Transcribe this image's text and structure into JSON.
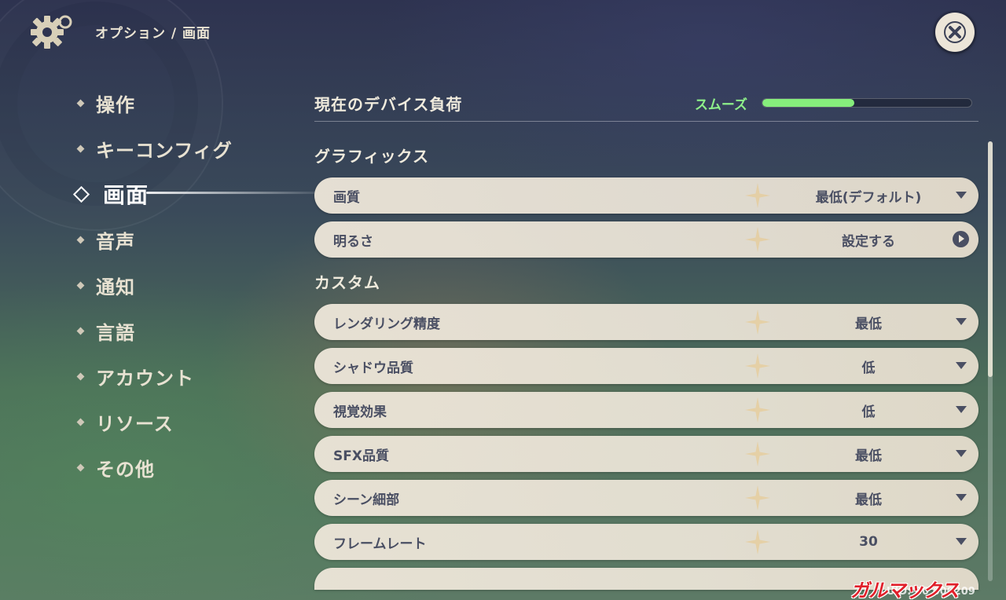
{
  "header": {
    "breadcrumb": "オプション / 画面"
  },
  "sidebar": {
    "items": [
      {
        "label": "操作"
      },
      {
        "label": "キーコンフィグ"
      },
      {
        "label": "画面"
      },
      {
        "label": "音声"
      },
      {
        "label": "通知"
      },
      {
        "label": "言語"
      },
      {
        "label": "アカウント"
      },
      {
        "label": "リソース"
      },
      {
        "label": "その他"
      }
    ],
    "active": "画面"
  },
  "device_load": {
    "title": "現在のデバイス負荷",
    "status": "スムーズ",
    "level": 0.44,
    "status_color": "#86ee7c"
  },
  "sections": {
    "graphics": "グラフィックス",
    "custom": "カスタム"
  },
  "graphics_options": [
    {
      "label": "画質",
      "value": "最低(デフォルト)",
      "control": "dropdown"
    },
    {
      "label": "明るさ",
      "value": "設定する",
      "control": "arrow"
    }
  ],
  "custom_options": [
    {
      "label": "レンダリング精度",
      "value": "最低",
      "control": "dropdown"
    },
    {
      "label": "シャドウ品質",
      "value": "低",
      "control": "dropdown"
    },
    {
      "label": "視覚効果",
      "value": "低",
      "control": "dropdown"
    },
    {
      "label": "SFX品質",
      "value": "最低",
      "control": "dropdown"
    },
    {
      "label": "シーン細部",
      "value": "最低",
      "control": "dropdown"
    },
    {
      "label": "フレームレート",
      "value": "30",
      "control": "dropdown"
    }
  ],
  "footer": {
    "uid": "UID: 80 600209",
    "watermark": "ガルマックス"
  },
  "icons": {
    "settings": "gear-icon",
    "close": "close-icon",
    "dropdown": "chevron-down-icon",
    "open": "arrow-right-circle-icon"
  }
}
